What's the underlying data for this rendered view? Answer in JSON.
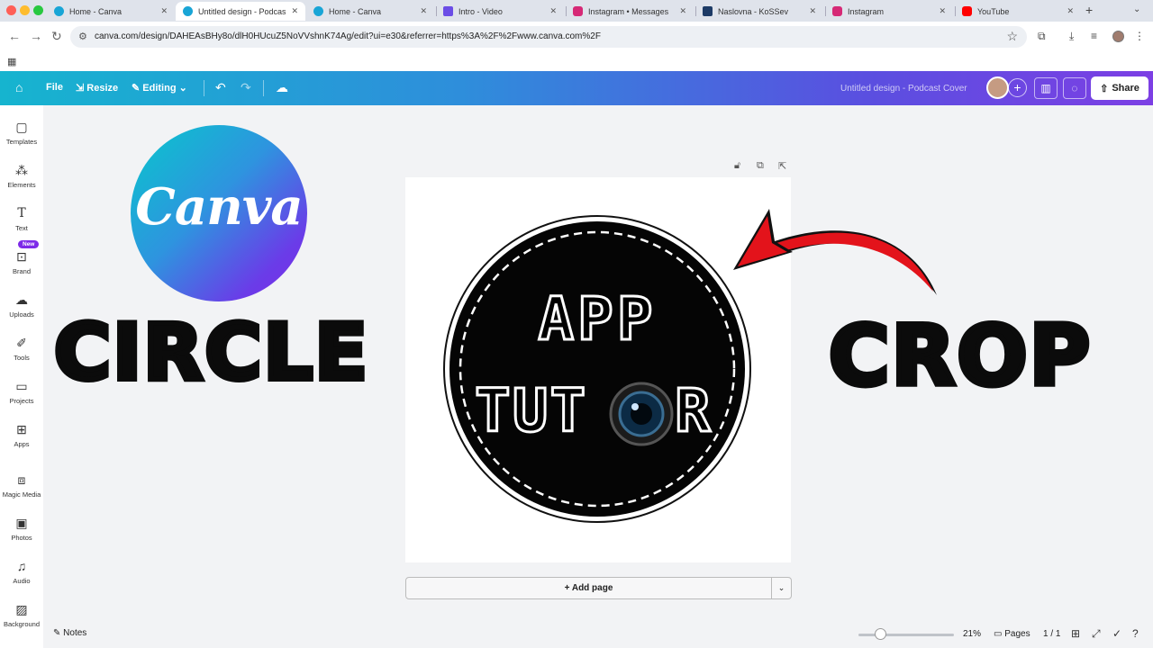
{
  "browser": {
    "tabs": [
      {
        "label": "Home - Canva",
        "favicon_color": "#19a5d6",
        "active": false
      },
      {
        "label": "Untitled design - Podcast",
        "favicon_color": "#19a5d6",
        "active": true
      },
      {
        "label": "Home - Canva",
        "favicon_color": "#19a5d6",
        "active": false
      },
      {
        "label": "Intro - Video",
        "favicon_color": "#6b4de6",
        "active": false
      },
      {
        "label": "Instagram • Messages",
        "favicon_color": "#d62976",
        "active": false
      },
      {
        "label": "Naslovna - KoSSev",
        "favicon_color": "#1d3b66",
        "active": false
      },
      {
        "label": "Instagram",
        "favicon_color": "#d62976",
        "active": false
      },
      {
        "label": "YouTube",
        "favicon_color": "#ff0000",
        "active": false
      }
    ],
    "url": "canva.com/design/DAHEAsBHy8o/dlH0HUcuZ5NoVVshnK74Ag/edit?ui=e30&referrer=https%3A%2F%2Fwww.canva.com%2F"
  },
  "header": {
    "file_label": "File",
    "resize_label": "Resize",
    "editing_label": "Editing",
    "design_title": "Untitled design - Podcast Cover",
    "share_label": "Share"
  },
  "rail": [
    {
      "label": "Templates",
      "icon": "template-icon"
    },
    {
      "label": "Elements",
      "icon": "elements-icon"
    },
    {
      "label": "Text",
      "icon": "text-icon"
    },
    {
      "label": "Brand",
      "icon": "brand-icon"
    },
    {
      "label": "Uploads",
      "icon": "upload-icon"
    },
    {
      "label": "Tools",
      "icon": "tools-icon"
    },
    {
      "label": "Projects",
      "icon": "folder-icon"
    },
    {
      "label": "Apps",
      "icon": "apps-icon"
    },
    {
      "label": "Magic Media",
      "icon": "magic-media-icon"
    },
    {
      "label": "Photos",
      "icon": "photos-icon"
    },
    {
      "label": "Audio",
      "icon": "audio-icon"
    },
    {
      "label": "Background",
      "icon": "background-icon"
    }
  ],
  "rail_new_badge": "New",
  "canvas": {
    "logo_text": "Canva",
    "word_left": "CIRCLE",
    "word_right": "CROP",
    "badge_line1": "APP",
    "badge_line2_a": "TUT",
    "badge_line2_b": "R",
    "add_page_label": "+ Add page"
  },
  "footer": {
    "notes_label": "Notes",
    "zoom_value": "21%",
    "pages_label": "Pages",
    "page_count": "1 / 1"
  },
  "colors": {
    "canva_gradient_start": "#16b4cf",
    "canva_gradient_end": "#7c3fe4",
    "arrow_red": "#e3131b",
    "brand_purple": "#7d2ae8"
  }
}
